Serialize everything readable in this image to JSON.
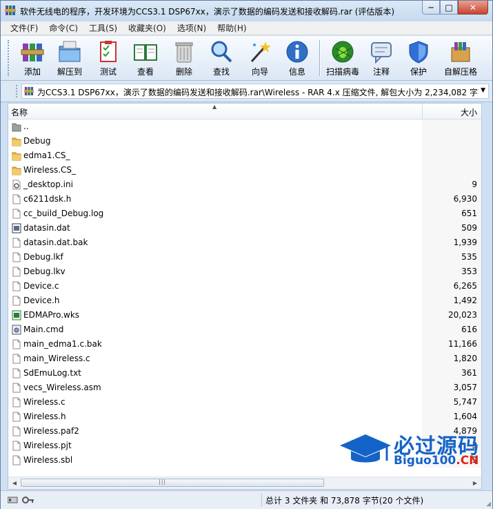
{
  "window": {
    "title": "软件无线电的程序，开发环境为CCS3.1 DSP67xx，演示了数据的编码发送和接收解码.rar (评估版本)",
    "controls": {
      "minimize": "─",
      "maximize": "□",
      "close": "✕"
    }
  },
  "menu": [
    "文件(F)",
    "命令(C)",
    "工具(S)",
    "收藏夹(O)",
    "选项(N)",
    "帮助(H)"
  ],
  "toolbar": [
    {
      "label": "添加",
      "icon": "add-archive-icon"
    },
    {
      "label": "解压到",
      "icon": "extract-to-icon"
    },
    {
      "label": "测试",
      "icon": "test-icon"
    },
    {
      "label": "查看",
      "icon": "view-icon"
    },
    {
      "label": "删除",
      "icon": "delete-icon"
    },
    {
      "label": "查找",
      "icon": "find-icon"
    },
    {
      "label": "向导",
      "icon": "wizard-icon"
    },
    {
      "label": "信息",
      "icon": "info-icon"
    },
    {
      "label": "扫描病毒",
      "icon": "virus-scan-icon"
    },
    {
      "label": "注释",
      "icon": "comment-icon"
    },
    {
      "label": "保护",
      "icon": "protect-icon"
    },
    {
      "label": "自解压格",
      "icon": "sfx-icon"
    }
  ],
  "address": {
    "path": "为CCS3.1 DSP67xx，演示了数据的编码发送和接收解码.rar\\Wireless - RAR 4.x 压缩文件, 解包大小为 2,234,082 字节"
  },
  "columns": {
    "name": "名称",
    "size": "大小"
  },
  "files": [
    {
      "name": "..",
      "size": "",
      "type": "parent"
    },
    {
      "name": "Debug",
      "size": "",
      "type": "folder"
    },
    {
      "name": "edma1.CS_",
      "size": "",
      "type": "folder"
    },
    {
      "name": "Wireless.CS_",
      "size": "",
      "type": "folder"
    },
    {
      "name": "_desktop.ini",
      "size": "9",
      "type": "settings"
    },
    {
      "name": "c6211dsk.h",
      "size": "6,930",
      "type": "file"
    },
    {
      "name": "cc_build_Debug.log",
      "size": "651",
      "type": "file"
    },
    {
      "name": "datasin.dat",
      "size": "509",
      "type": "dat"
    },
    {
      "name": "datasin.dat.bak",
      "size": "1,939",
      "type": "file"
    },
    {
      "name": "Debug.lkf",
      "size": "535",
      "type": "file"
    },
    {
      "name": "Debug.lkv",
      "size": "353",
      "type": "file"
    },
    {
      "name": "Device.c",
      "size": "6,265",
      "type": "file"
    },
    {
      "name": "Device.h",
      "size": "1,492",
      "type": "file"
    },
    {
      "name": "EDMAPro.wks",
      "size": "20,023",
      "type": "wks"
    },
    {
      "name": "Main.cmd",
      "size": "616",
      "type": "cmd"
    },
    {
      "name": "main_edma1.c.bak",
      "size": "11,166",
      "type": "file"
    },
    {
      "name": "main_Wireless.c",
      "size": "1,820",
      "type": "file"
    },
    {
      "name": "SdEmuLog.txt",
      "size": "361",
      "type": "file"
    },
    {
      "name": "vecs_Wireless.asm",
      "size": "3,057",
      "type": "file"
    },
    {
      "name": "Wireless.c",
      "size": "5,747",
      "type": "file"
    },
    {
      "name": "Wireless.h",
      "size": "1,604",
      "type": "file"
    },
    {
      "name": "Wireless.paf2",
      "size": "4,879",
      "type": "file"
    },
    {
      "name": "Wireless.pjt",
      "size": "3",
      "type": "file"
    },
    {
      "name": "Wireless.sbl",
      "size": "9",
      "type": "file"
    }
  ],
  "status": {
    "text": "总计 3 文件夹 和 73,878 字节(20 个文件)"
  },
  "watermark": {
    "cn": "必过源码",
    "en_main": "Biguo100",
    "en_suffix": ".CN"
  },
  "colors": {
    "accent": "#1463c8",
    "watermark_red": "#e0241b",
    "folder": "#e8b84a"
  }
}
